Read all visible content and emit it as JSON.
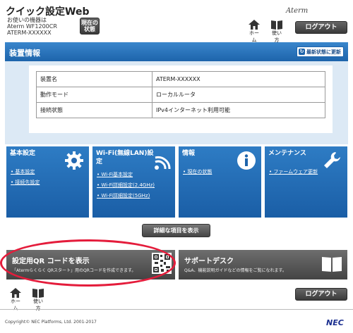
{
  "header": {
    "title": "クイック設定Web",
    "device_label": "お使いの機器は",
    "model": "Aterm WF1200CR",
    "ssid": "ATERM-XXXXXX",
    "status_button": "現在の\n状態",
    "logo": "Aterm",
    "home": "ホーム",
    "usage": "使い方",
    "logout": "ログアウト"
  },
  "panel": {
    "title": "装置情報",
    "refresh": "最新状態に更新",
    "rows": [
      {
        "key": "装置名",
        "value": "ATERM-XXXXXX"
      },
      {
        "key": "動作モード",
        "value": "ローカルルータ"
      },
      {
        "key": "接続状態",
        "value": "IPv4インターネット利用可能"
      }
    ]
  },
  "tiles": [
    {
      "title": "基本設定",
      "links": [
        "基本設定",
        "接続先設定"
      ],
      "icon": "gear-icon"
    },
    {
      "title": "Wi-Fi(無線LAN)設\n定",
      "links": [
        "Wi-Fi基本設定",
        "Wi-Fi詳細設定(2.4GHz)",
        "Wi-Fi詳細設定(5GHz)"
      ],
      "icon": "wifi-icon"
    },
    {
      "title": "情報",
      "links": [
        "現在の状態"
      ],
      "icon": "info-icon"
    },
    {
      "title": "メンテナンス",
      "links": [
        "ファームウェア更新"
      ],
      "icon": "wrench-icon"
    }
  ],
  "detail_button": "詳細な項目を表示",
  "qr_card": {
    "title": "設定用QR コードを表示",
    "subtitle": "「Atermらくらく QRスタート」用のQRコードを作成できます。"
  },
  "support_card": {
    "title": "サポートデスク",
    "subtitle": "Q&A、機能説明ガイドなどの情報をご覧になれます。"
  },
  "footer": {
    "home": "ホーム",
    "usage": "使い方",
    "logout": "ログアウト",
    "copyright": "Copyright© NEC Platforms, Ltd. 2001-2017",
    "brand": "NEC"
  }
}
